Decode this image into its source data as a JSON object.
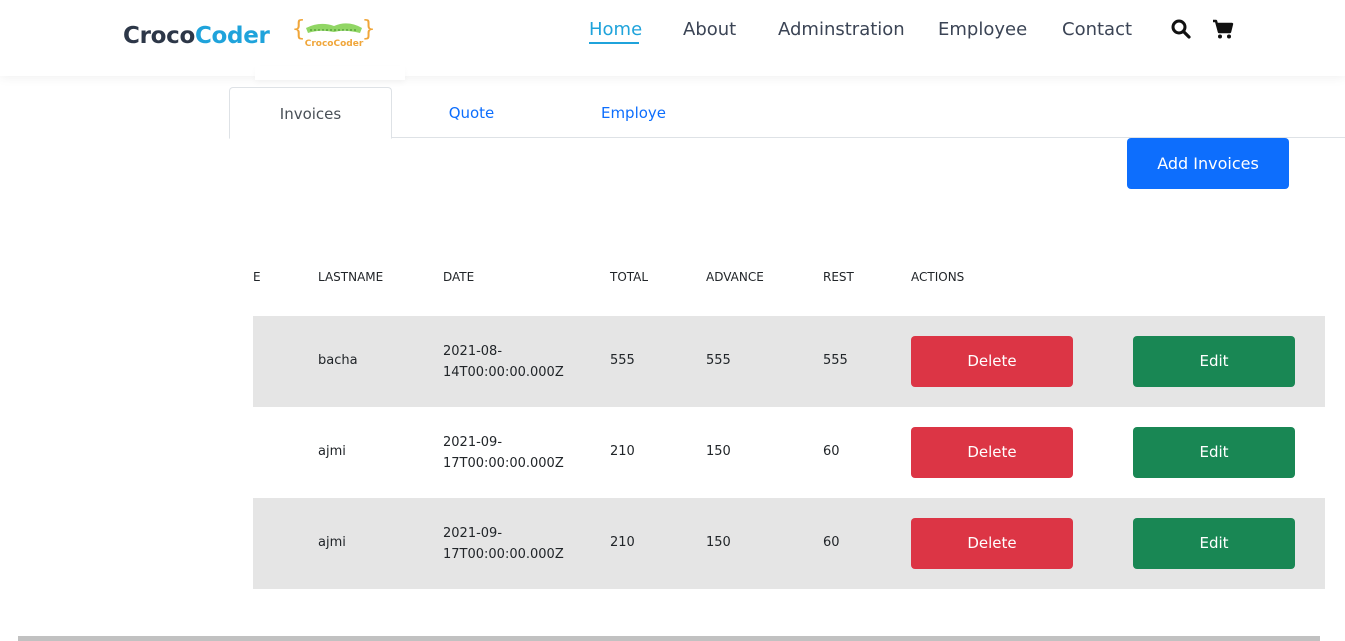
{
  "brand": {
    "part1": "Croco",
    "part2": "Coder",
    "logo_text": "CrocoCoder"
  },
  "nav": {
    "items": [
      {
        "label": "Home",
        "active": true
      },
      {
        "label": "About"
      },
      {
        "label": "Adminstration"
      },
      {
        "label": "Employee"
      },
      {
        "label": "Contact"
      }
    ],
    "icons": [
      "search-icon",
      "cart-icon"
    ]
  },
  "tabs": [
    {
      "label": "Invoices",
      "active": true
    },
    {
      "label": "Quote"
    },
    {
      "label": "Employe"
    }
  ],
  "add_button": "Add Invoices",
  "table": {
    "headers": [
      "E",
      "LASTNAME",
      "DATE",
      "TOTAL",
      "ADVANCE",
      "REST",
      "ACTIONS"
    ],
    "rows": [
      {
        "lastname": "bacha",
        "date_a": "2021-08-",
        "date_b": "14T00:00:00.000Z",
        "total": "555",
        "advance": "555",
        "rest": "555",
        "delete": "Delete",
        "edit": "Edit"
      },
      {
        "lastname": "ajmi",
        "date_a": "2021-09-",
        "date_b": "17T00:00:00.000Z",
        "total": "210",
        "advance": "150",
        "rest": "60",
        "delete": "Delete",
        "edit": "Edit"
      },
      {
        "lastname": "ajmi",
        "date_a": "2021-09-",
        "date_b": "17T00:00:00.000Z",
        "total": "210",
        "advance": "150",
        "rest": "60",
        "delete": "Delete",
        "edit": "Edit"
      }
    ]
  },
  "colors": {
    "accent": "#1fa3db",
    "primary": "#0d6efd",
    "danger": "#dc3545",
    "success": "#198754",
    "stripe": "#e5e5e5"
  }
}
